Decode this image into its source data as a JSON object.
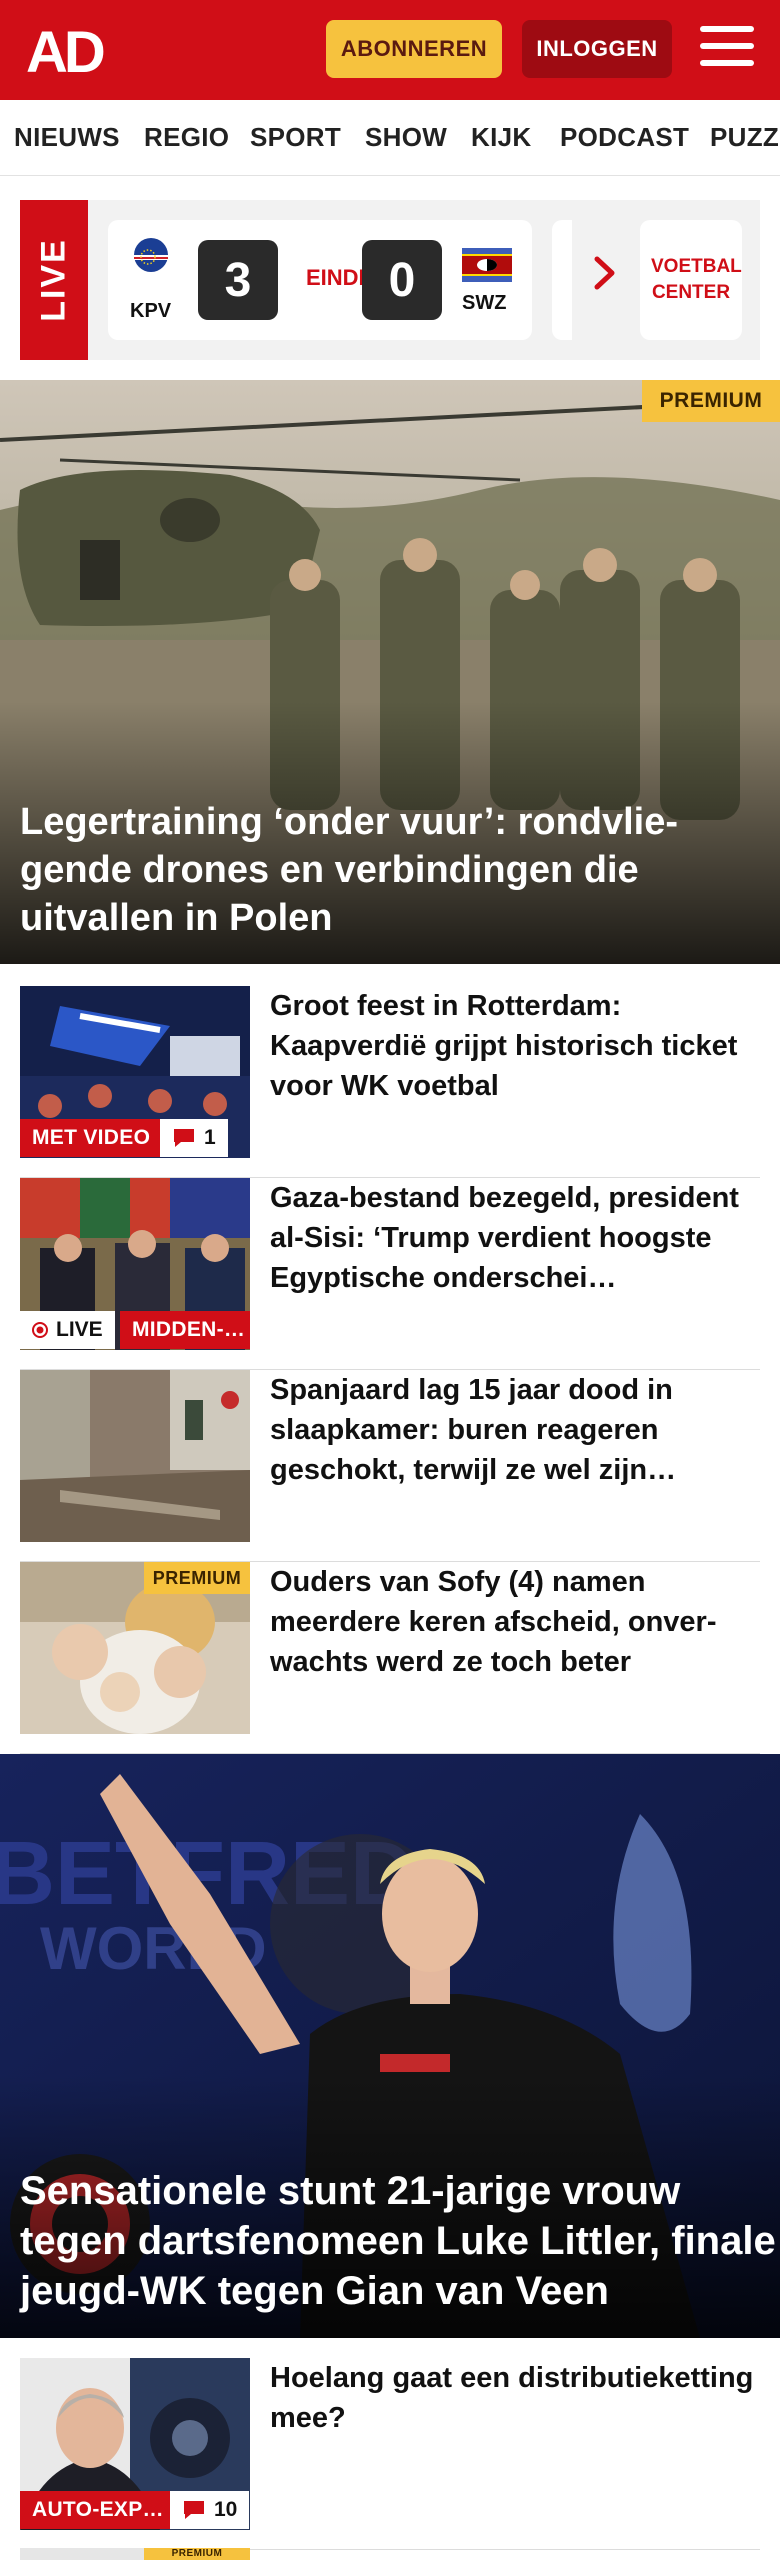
{
  "header": {
    "logo_text": "AD",
    "subscribe_label": "ABONNEREN",
    "login_label": "INLOGGEN",
    "menu_icon": "hamburger-icon",
    "brand_color": "#d00e17"
  },
  "nav": {
    "items": [
      "NIEUWS",
      "REGIO",
      "SPORT",
      "SHOW",
      "KIJK",
      "PODCAST",
      "PUZZ"
    ]
  },
  "live": {
    "label": "LIVE",
    "match": {
      "home_team": "KPV",
      "home_score": "3",
      "status": "EINDE",
      "away_score": "0",
      "away_team": "SWZ"
    },
    "more_icon": "chevron-right-icon",
    "voetbal_center": "VOETBAL CENTER"
  },
  "hero": {
    "badge": "PREMIUM",
    "title": "Legertraining ‘onder vuur’: rondvlie­gende drones en verbindingen die uitvallen in Polen"
  },
  "articles": [
    {
      "title": "Groot feest in Rotterdam: Kaapverdië grijpt historisch ticket voor WK voetbal",
      "tag": "MET VIDEO",
      "comments": "1"
    },
    {
      "title": "Gaza-bestand bezegeld, president al-Sisi: ‘Trump verdient hoogste Egyptische onderschei…",
      "live_label": "LIVE",
      "tag": "MIDDEN-…"
    },
    {
      "title": "Spanjaard lag 15 jaar dood in slaapkamer: buren reageren geschokt, terwijl ze wel zijn…"
    },
    {
      "title": "Ouders van Sofy (4) namen meerdere keren afscheid, onver­wachts werd ze toch beter",
      "badge": "PREMIUM"
    }
  ],
  "hero2": {
    "title": "Sensationele stunt 21-jarige vrouw tegen dartsfenomeen Luke Littler, finale jeugd-WK tegen Gian van Veen"
  },
  "articles2": [
    {
      "title": "Hoelang gaat een distributieket­ting mee?",
      "tag": "AUTO-EXP…",
      "comments": "10"
    },
    {
      "badge": "PREMIUM"
    }
  ]
}
